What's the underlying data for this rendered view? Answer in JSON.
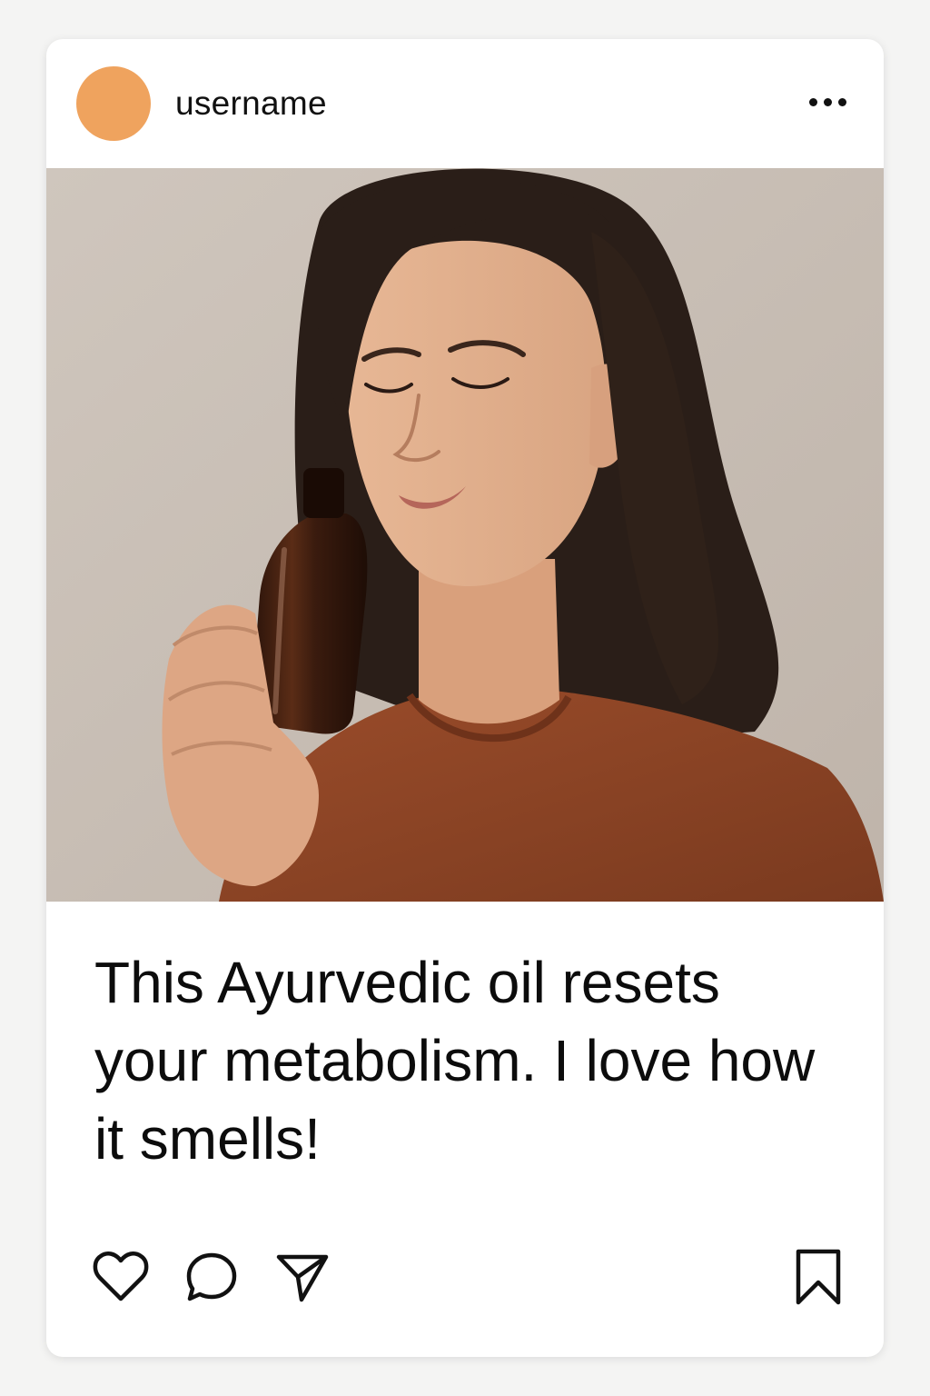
{
  "post": {
    "username": "username",
    "avatar_color": "#EFA35E",
    "caption": "This Ayurvedic oil resets your metabolism. I love how it smells!",
    "photo_subject": "woman with closed eyes smelling an amber glass oil bottle"
  },
  "icons": {
    "more": "more-options-icon",
    "like": "heart-icon",
    "comment": "comment-bubble-icon",
    "share": "send-paper-plane-icon",
    "save": "bookmark-icon"
  },
  "colors": {
    "card_background": "#FFFFFF",
    "text": "#111111",
    "photo_background": "#C9BFB6",
    "shirt": "#8B4325",
    "hair": "#2A1E18",
    "skin": "#E2B08E",
    "bottle": "#3B1D10"
  }
}
